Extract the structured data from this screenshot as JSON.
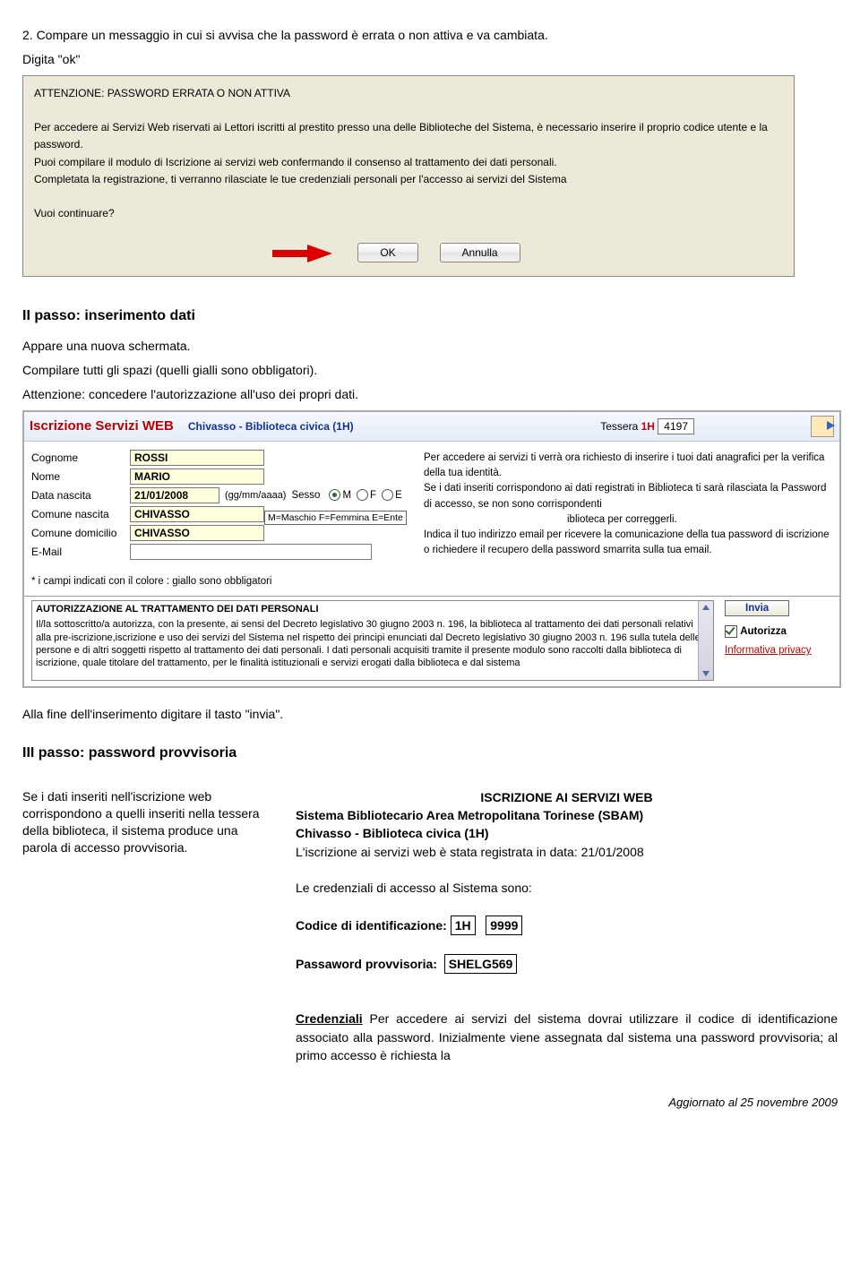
{
  "intro": {
    "line1": "2. Compare un messaggio in cui si avvisa che la password è errata o non attiva e va cambiata.",
    "line2": "Digita \"ok\""
  },
  "dialog": {
    "title": "ATTENZIONE: PASSWORD ERRATA O NON ATTIVA",
    "p1": "Per accedere ai Servizi Web riservati ai Lettori iscritti al prestito presso una delle Biblioteche del Sistema, è necessario inserire il proprio codice utente e la password.",
    "p2": "Puoi compilare il modulo di Iscrizione ai servizi web  confermando il consenso al trattamento dei dati personali.",
    "p3": "Completata la registrazione, ti verranno rilasciate le tue credenziali personali per l'accesso ai servizi del Sistema",
    "p4": "Vuoi continuare?",
    "ok": "OK",
    "cancel": "Annulla"
  },
  "step2": {
    "heading": "II passo: inserimento dati",
    "l1": "Appare una nuova schermata.",
    "l2": "Compilare tutti gli spazi (quelli gialli sono obbligatori).",
    "l3": "Attenzione: concedere l'autorizzazione all'uso dei propri dati."
  },
  "form": {
    "title": "Iscrizione Servizi WEB",
    "sub": "Chivasso - Biblioteca civica (1H)",
    "tessera_label": "Tessera",
    "tessera_code": "1H",
    "tessera_num": "4197",
    "labels": {
      "cognome": "Cognome",
      "nome": "Nome",
      "dn": "Data nascita",
      "dfmt": "(gg/mm/aaaa)",
      "sesso": "Sesso",
      "cn": "Comune nascita",
      "cd": "Comune domicilio",
      "email": "E-Mail"
    },
    "values": {
      "cognome": "ROSSI",
      "nome": "MARIO",
      "dn": "21/01/2008",
      "cn": "CHIVASSO",
      "cd": "CHIVASSO"
    },
    "sex_opts": {
      "m": "M",
      "f": "F",
      "e": "E"
    },
    "mfe": "M=Maschio F=Femmina E=Ente",
    "right": {
      "p1": "Per accedere ai servizi ti verrà ora richiesto di inserire i tuoi dati anagrafici per la verifica della tua identità.",
      "p2": "Se i dati inseriti corrispondono ai dati registrati in Biblioteca ti sarà rilasciata la Password di accesso, se non sono corrispondenti",
      "p2b": "iblioteca per correggerli.",
      "p3": "Indica il tuo indirizzo email per ricevere la comunicazione della tua password di iscrizione o richiedere il recupero della password smarrita sulla tua email."
    },
    "note": "* i campi indicati con il colore : giallo sono obbligatori",
    "auth_title": "AUTORIZZAZIONE AL TRATTAMENTO DEI DATI PERSONALI",
    "auth_body": "Il/la sottoscritto/a autorizza, con la presente, ai sensi del Decreto legislativo 30 giugno 2003 n. 196, la biblioteca al trattamento dei dati personali relativi alla pre-iscrizione,iscrizione e uso dei servizi del Sistema nel rispetto dei principi enunciati dal Decreto legislativo 30 giugno 2003 n. 196 sulla tutela delle persone e di altri soggetti rispetto al trattamento dei dati personali. I dati personali acquisiti tramite il presente modulo sono raccolti dalla biblioteca di iscrizione, quale titolare del trattamento, per le finalità istituzionali e servizi erogati dalla biblioteca e dal sistema",
    "invia": "Invia",
    "autorizza": "Autorizza",
    "privacy": "Informativa privacy"
  },
  "after_form": "Alla fine dell'inserimento digitare il tasto \"invia\".",
  "step3": {
    "heading": "III passo: password provvisoria",
    "left": "Se i dati inseriti nell'iscrizione web corrispondono a quelli inseriti nella tessera della biblioteca, il sistema produce una parola di accesso provvisoria.",
    "right_title": "ISCRIZIONE AI SERVIZI WEB",
    "right_sys": "Sistema Bibliotecario Area Metropolitana Torinese (SBAM)",
    "right_lib": "Chivasso - Biblioteca civica (1H)",
    "right_reg": "L'iscrizione ai servizi web è stata registrata in data: 21/01/2008",
    "right_cred": "Le credenziali di accesso al Sistema sono:",
    "cod_label": "Codice di identificazione:",
    "cod_a": "1H",
    "cod_b": "9999",
    "pw_label": "Passaword provvisoria:",
    "pw_val": "SHELG569",
    "cred_h": "Credenziali",
    "cred_txt": " Per accedere ai servizi del sistema dovrai utilizzare il codice di identificazione associato alla password. Inizialmente viene assegnata dal sistema una password provvisoria; al primo accesso è richiesta la"
  },
  "footer": "Aggiornato al 25 novembre 2009"
}
